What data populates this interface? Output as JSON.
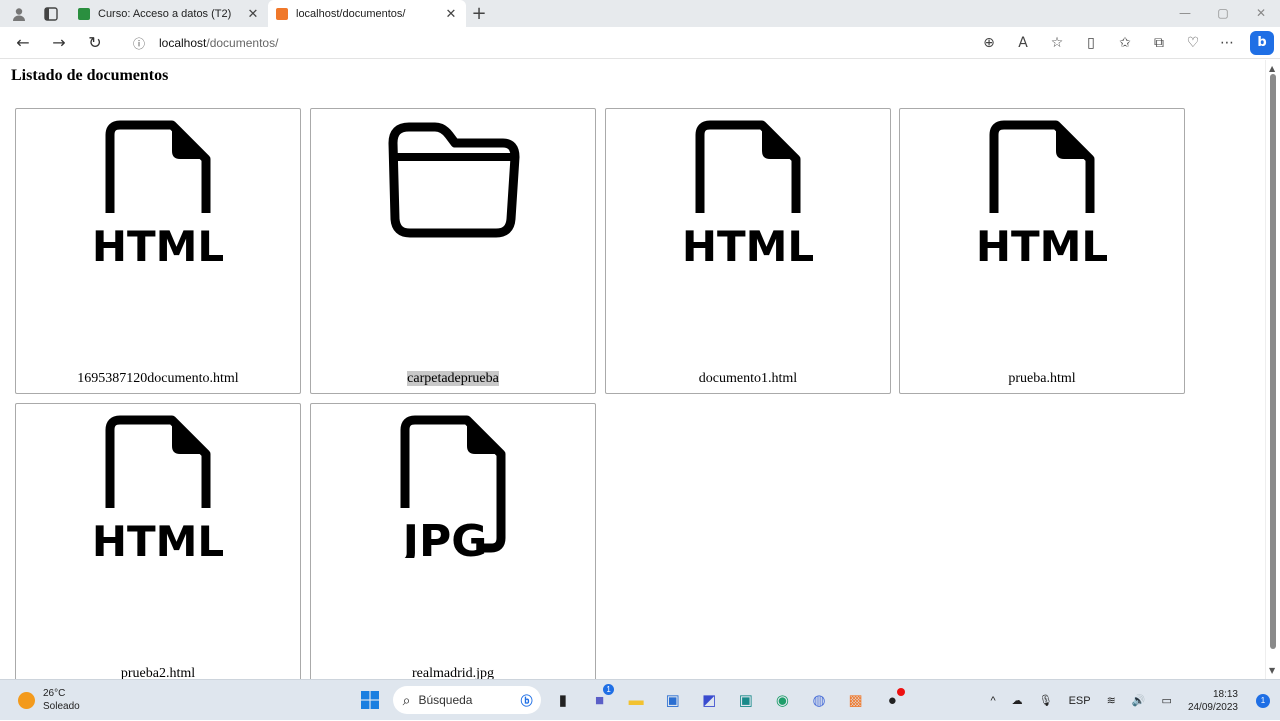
{
  "browser": {
    "tabs": [
      {
        "title": "Curso: Acceso a datos (T2)",
        "favicon_color": "#2a8f3f",
        "active": false
      },
      {
        "title": "localhost/documentos/",
        "favicon_color": "#f0782a",
        "active": true
      }
    ],
    "url_host": "localhost",
    "url_path": "/documentos/",
    "icons": {
      "profile": "profile-icon",
      "tab_actions": "tab-actions-icon",
      "new_tab": "+",
      "back": "back-arrow-icon",
      "forward": "forward-arrow-icon",
      "reload": "reload-icon",
      "info": "info-icon",
      "zoom": "zoom-icon",
      "read_aloud": "read-aloud-icon",
      "favorite": "star-icon",
      "split": "split-screen-icon",
      "favorites": "favorites-icon",
      "collections": "collections-icon",
      "extensions": "heart-icon",
      "more": "more-icon",
      "bing": "b"
    }
  },
  "page": {
    "heading": "Listado de documentos",
    "items": [
      {
        "name": "1695387120documento.html",
        "type": "html",
        "label": "HTML"
      },
      {
        "name": "carpetadeprueba",
        "type": "folder",
        "label": "",
        "selected": true
      },
      {
        "name": "documento1.html",
        "type": "html",
        "label": "HTML"
      },
      {
        "name": "prueba.html",
        "type": "html",
        "label": "HTML"
      },
      {
        "name": "prueba2.html",
        "type": "html",
        "label": "HTML"
      },
      {
        "name": "realmadrid.jpg",
        "type": "jpg",
        "label": "JPG"
      }
    ]
  },
  "taskbar": {
    "temperature": "26°C",
    "condition": "Soleado",
    "search_placeholder": "Búsqueda",
    "teams_badge": "1",
    "language": "ESP",
    "time": "18:13",
    "date": "24/09/2023",
    "notifications": "1"
  }
}
